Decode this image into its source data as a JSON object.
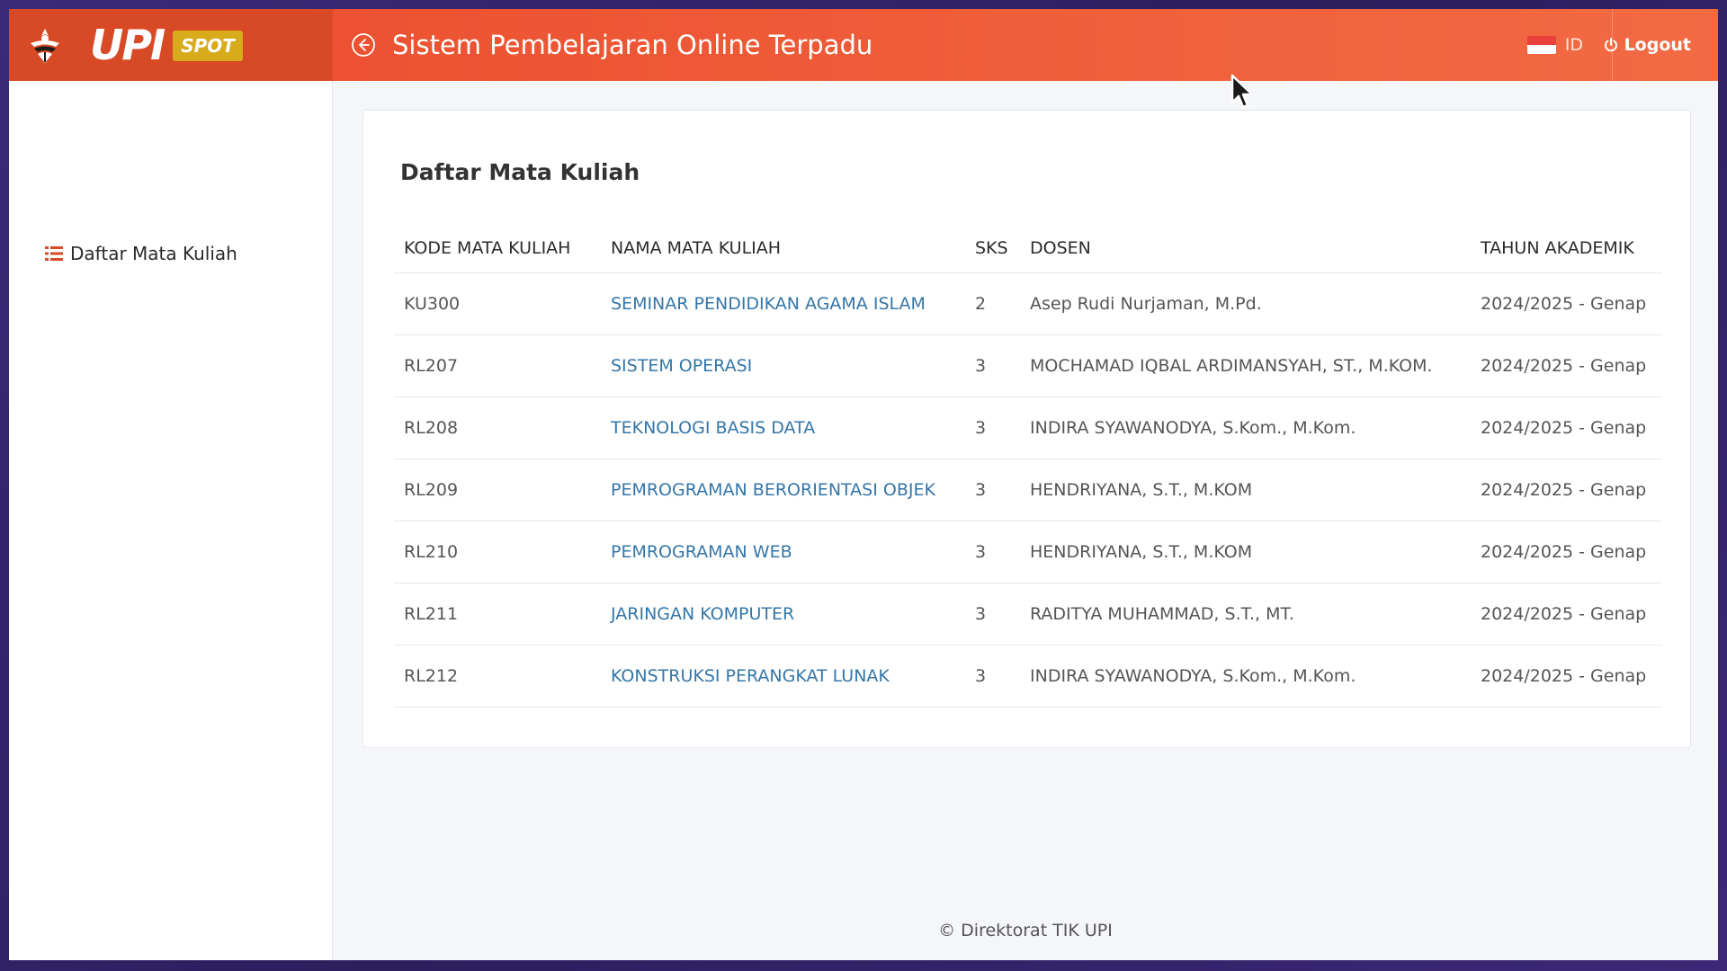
{
  "header": {
    "brand_word": "UPI",
    "brand_badge": "SPOT",
    "title": "Sistem Pembelajaran Online Terpadu",
    "language": "ID",
    "logout_label": "Logout",
    "accent_color": "#d84a25"
  },
  "sidebar": {
    "items": [
      {
        "label": "Daftar Mata Kuliah",
        "icon": "list-icon"
      }
    ]
  },
  "main": {
    "card_title": "Daftar Mata Kuliah",
    "table": {
      "columns": [
        "KODE MATA KULIAH",
        "NAMA MATA KULIAH",
        "SKS",
        "DOSEN",
        "TAHUN AKADEMIK"
      ],
      "rows": [
        {
          "code": "KU300",
          "name": "SEMINAR PENDIDIKAN AGAMA ISLAM",
          "sks": "2",
          "lecturer": "Asep Rudi Nurjaman, M.Pd.",
          "year": "2024/2025 - Genap"
        },
        {
          "code": "RL207",
          "name": "SISTEM OPERASI",
          "sks": "3",
          "lecturer": "MOCHAMAD IQBAL ARDIMANSYAH, ST., M.KOM.",
          "year": "2024/2025 - Genap"
        },
        {
          "code": "RL208",
          "name": "TEKNOLOGI BASIS DATA",
          "sks": "3",
          "lecturer": "INDIRA SYAWANODYA, S.Kom., M.Kom.",
          "year": "2024/2025 - Genap"
        },
        {
          "code": "RL209",
          "name": "PEMROGRAMAN BERORIENTASI OBJEK",
          "sks": "3",
          "lecturer": "HENDRIYANA, S.T., M.KOM",
          "year": "2024/2025 - Genap"
        },
        {
          "code": "RL210",
          "name": "PEMROGRAMAN WEB",
          "sks": "3",
          "lecturer": "HENDRIYANA, S.T., M.KOM",
          "year": "2024/2025 - Genap"
        },
        {
          "code": "RL211",
          "name": "JARINGAN KOMPUTER",
          "sks": "3",
          "lecturer": "RADITYA MUHAMMAD, S.T., MT.",
          "year": "2024/2025 - Genap"
        },
        {
          "code": "RL212",
          "name": "KONSTRUKSI PERANGKAT LUNAK",
          "sks": "3",
          "lecturer": "INDIRA SYAWANODYA, S.Kom., M.Kom.",
          "year": "2024/2025 - Genap"
        }
      ]
    }
  },
  "footer": {
    "text": "© Direktorat TIK UPI"
  }
}
